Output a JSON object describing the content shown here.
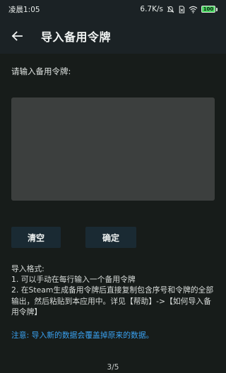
{
  "status_bar": {
    "time": "凌晨1:05",
    "net_speed": "6.7K/s",
    "battery": "100"
  },
  "app_bar": {
    "back_icon": "arrow-left-icon",
    "title": "导入备用令牌"
  },
  "form": {
    "prompt": "请输入备用令牌:",
    "input_value": "",
    "clear_label": "清空",
    "confirm_label": "确定"
  },
  "format": {
    "heading": "导入格式:",
    "line1": "1. 可以手动在每行输入一个备用令牌",
    "line2": "2. 在Steam生成备用令牌后直接复制包含序号和令牌的全部输出，然后粘贴到本应用中。详见【帮助】->【如何导入备用令牌】"
  },
  "note": "注意: 导入新的数据会覆盖掉原来的数据。",
  "page_indicator": "3/5",
  "colors": {
    "background": "#171c1a",
    "bar": "#1b2225",
    "input": "#3c3f3e",
    "button": "#1a2a33",
    "note": "#3aa2f2"
  }
}
